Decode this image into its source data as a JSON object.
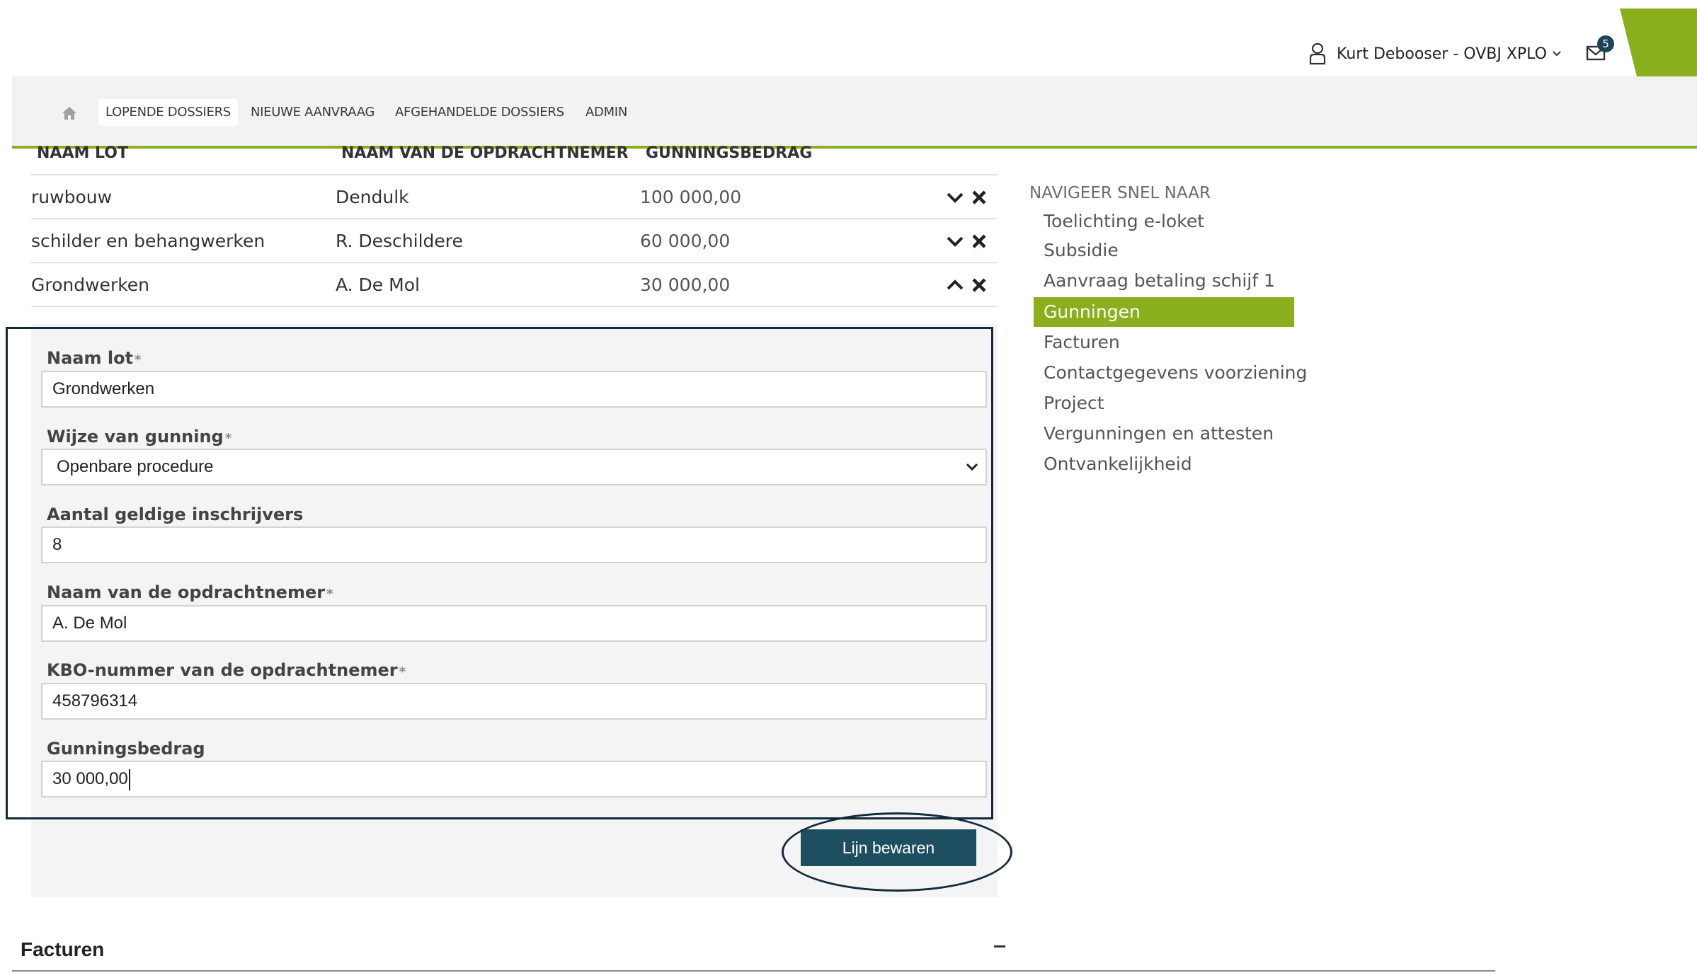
{
  "header": {
    "user_name": "Kurt Debooser - OVBJ XPLO",
    "mail_count": "5",
    "accent_color": "#8bae1c",
    "icons": [
      "user-icon",
      "chevron-down-icon",
      "mail-icon",
      "home-icon"
    ]
  },
  "nav": {
    "items": [
      {
        "label": "LOPENDE DOSSIERS",
        "active": true
      },
      {
        "label": "NIEUWE AANVRAAG",
        "active": false
      },
      {
        "label": "AFGEHANDELDE DOSSIERS",
        "active": false
      },
      {
        "label": "ADMIN",
        "active": false
      }
    ]
  },
  "lots_table": {
    "columns": [
      "NAAM LOT",
      "NAAM VAN DE OPDRACHTNEMER",
      "GUNNINGSBEDRAG"
    ],
    "rows": [
      {
        "naam_lot": "ruwbouw",
        "opdrachtnemer": "Dendulk",
        "bedrag": "100 000,00",
        "expanded": false
      },
      {
        "naam_lot": "schilder en behangwerken",
        "opdrachtnemer": "R. Deschildere",
        "bedrag": "60 000,00",
        "expanded": false
      },
      {
        "naam_lot": "Grondwerken",
        "opdrachtnemer": "A. De Mol",
        "bedrag": "30 000,00",
        "expanded": true
      }
    ]
  },
  "form": {
    "required_mark": "*",
    "naam_lot": {
      "label": "Naam lot",
      "value": "Grondwerken"
    },
    "wijze_van_gunning": {
      "label": "Wijze van gunning",
      "value": "Openbare procedure"
    },
    "aantal_inschrijvers": {
      "label": "Aantal geldige inschrijvers",
      "value": "8"
    },
    "opdrachtnemer": {
      "label": "Naam van de opdrachtnemer",
      "value": "A. De Mol"
    },
    "kbo_nummer": {
      "label": "KBO-nummer van de opdrachtnemer",
      "value": "458796314"
    },
    "gunningsbedrag": {
      "label": "Gunningsbedrag",
      "value": "30 000,00"
    },
    "save_label": "Lijn bewaren"
  },
  "facturen": {
    "title": "Facturen",
    "toggle": "collapse"
  },
  "quick_nav": {
    "title": "NAVIGEER SNEL NAAR",
    "items": [
      {
        "label": "Toelichting e-loket",
        "active": false
      },
      {
        "label": "Subsidie",
        "active": false
      },
      {
        "label": "Aanvraag betaling schijf 1",
        "active": false
      },
      {
        "label": "Gunningen",
        "active": true
      },
      {
        "label": "Facturen",
        "active": false
      },
      {
        "label": "Contactgegevens voorziening",
        "active": false
      },
      {
        "label": "Project",
        "active": false
      },
      {
        "label": "Vergunningen en attesten",
        "active": false
      },
      {
        "label": "Ontvankelijkheid",
        "active": false
      }
    ]
  }
}
